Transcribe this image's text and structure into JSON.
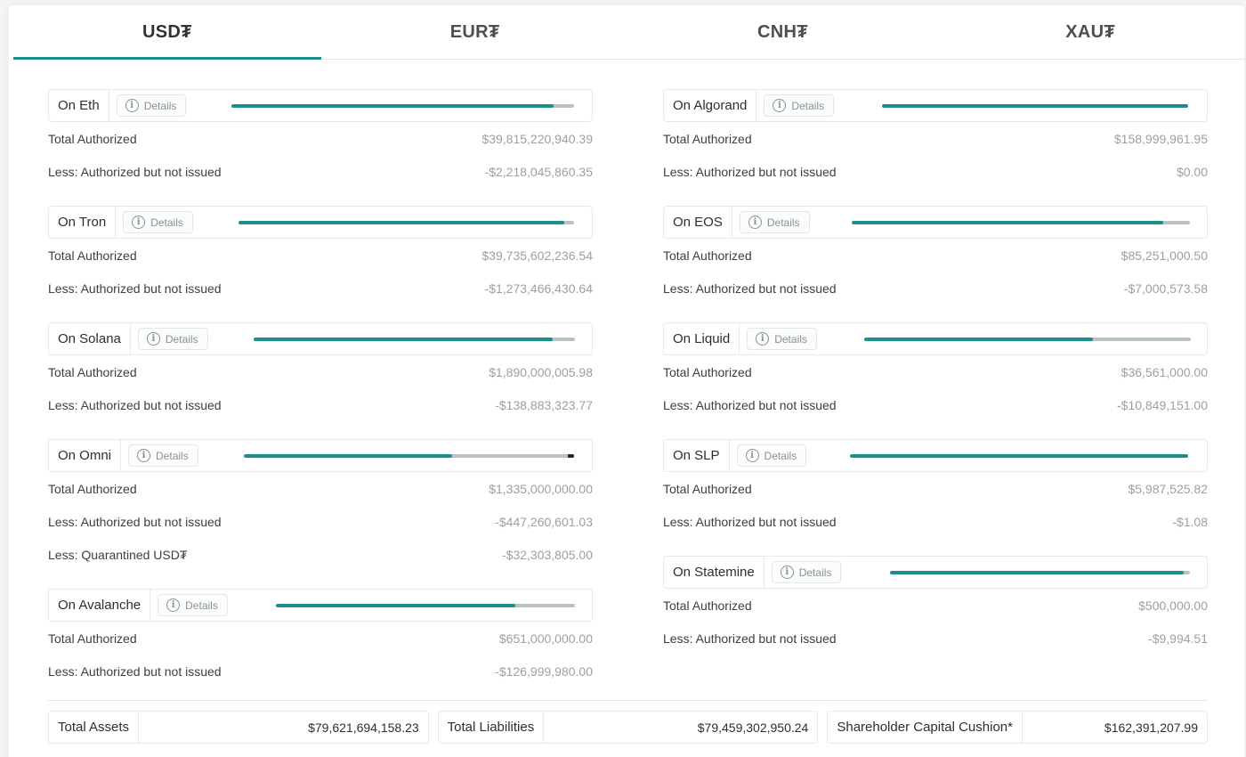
{
  "tabs": [
    {
      "label": "USD₮",
      "active": true
    },
    {
      "label": "EUR₮",
      "active": false
    },
    {
      "label": "CNH₮",
      "active": false
    },
    {
      "label": "XAU₮",
      "active": false
    }
  ],
  "details_label": "Details",
  "colors": {
    "accent": "#1c8f8a",
    "track": "#b9c2c2"
  },
  "left_chains": [
    {
      "name": "On Eth",
      "fill": 0.94,
      "rows": [
        {
          "label": "Total Authorized",
          "value": "$39,815,220,940.39"
        },
        {
          "label": "Less: Authorized but not issued",
          "value": "-$2,218,045,860.35"
        }
      ]
    },
    {
      "name": "On Tron",
      "fill": 0.97,
      "rows": [
        {
          "label": "Total Authorized",
          "value": "$39,735,602,236.54"
        },
        {
          "label": "Less: Authorized but not issued",
          "value": "-$1,273,466,430.64"
        }
      ]
    },
    {
      "name": "On Solana",
      "fill": 0.93,
      "rows": [
        {
          "label": "Total Authorized",
          "value": "$1,890,000,005.98"
        },
        {
          "label": "Less: Authorized but not issued",
          "value": "-$138,883,323.77"
        }
      ]
    },
    {
      "name": "On Omni",
      "fill": 0.63,
      "dark": 0.02,
      "rows": [
        {
          "label": "Total Authorized",
          "value": "$1,335,000,000.00"
        },
        {
          "label": "Less: Authorized but not issued",
          "value": "-$447,260,601.03"
        },
        {
          "label": "Less: Quarantined USD₮",
          "value": "-$32,303,805.00"
        }
      ]
    },
    {
      "name": "On Avalanche",
      "fill": 0.8,
      "rows": [
        {
          "label": "Total Authorized",
          "value": "$651,000,000.00"
        },
        {
          "label": "Less: Authorized but not issued",
          "value": "-$126,999,980.00"
        }
      ]
    }
  ],
  "right_chains": [
    {
      "name": "On Algorand",
      "fill": 1.0,
      "rows": [
        {
          "label": "Total Authorized",
          "value": "$158,999,961.95"
        },
        {
          "label": "Less: Authorized but not issued",
          "value": "$0.00"
        }
      ]
    },
    {
      "name": "On EOS",
      "fill": 0.92,
      "rows": [
        {
          "label": "Total Authorized",
          "value": "$85,251,000.50"
        },
        {
          "label": "Less: Authorized but not issued",
          "value": "-$7,000,573.58"
        }
      ]
    },
    {
      "name": "On Liquid",
      "fill": 0.7,
      "rows": [
        {
          "label": "Total Authorized",
          "value": "$36,561,000.00"
        },
        {
          "label": "Less: Authorized but not issued",
          "value": "-$10,849,151.00"
        }
      ]
    },
    {
      "name": "On SLP",
      "fill": 1.0,
      "rows": [
        {
          "label": "Total Authorized",
          "value": "$5,987,525.82"
        },
        {
          "label": "Less: Authorized but not issued",
          "value": "-$1.08"
        }
      ]
    },
    {
      "name": "On Statemine",
      "fill": 0.98,
      "rows": [
        {
          "label": "Total Authorized",
          "value": "$500,000.00"
        },
        {
          "label": "Less: Authorized but not issued",
          "value": "-$9,994.51"
        }
      ]
    }
  ],
  "totals": [
    {
      "label": "Total Assets",
      "value": "$79,621,694,158.23"
    },
    {
      "label": "Total Liabilities",
      "value": "$79,459,302,950.24"
    },
    {
      "label": "Shareholder Capital Cushion*",
      "value": "$162,391,207.99"
    }
  ]
}
